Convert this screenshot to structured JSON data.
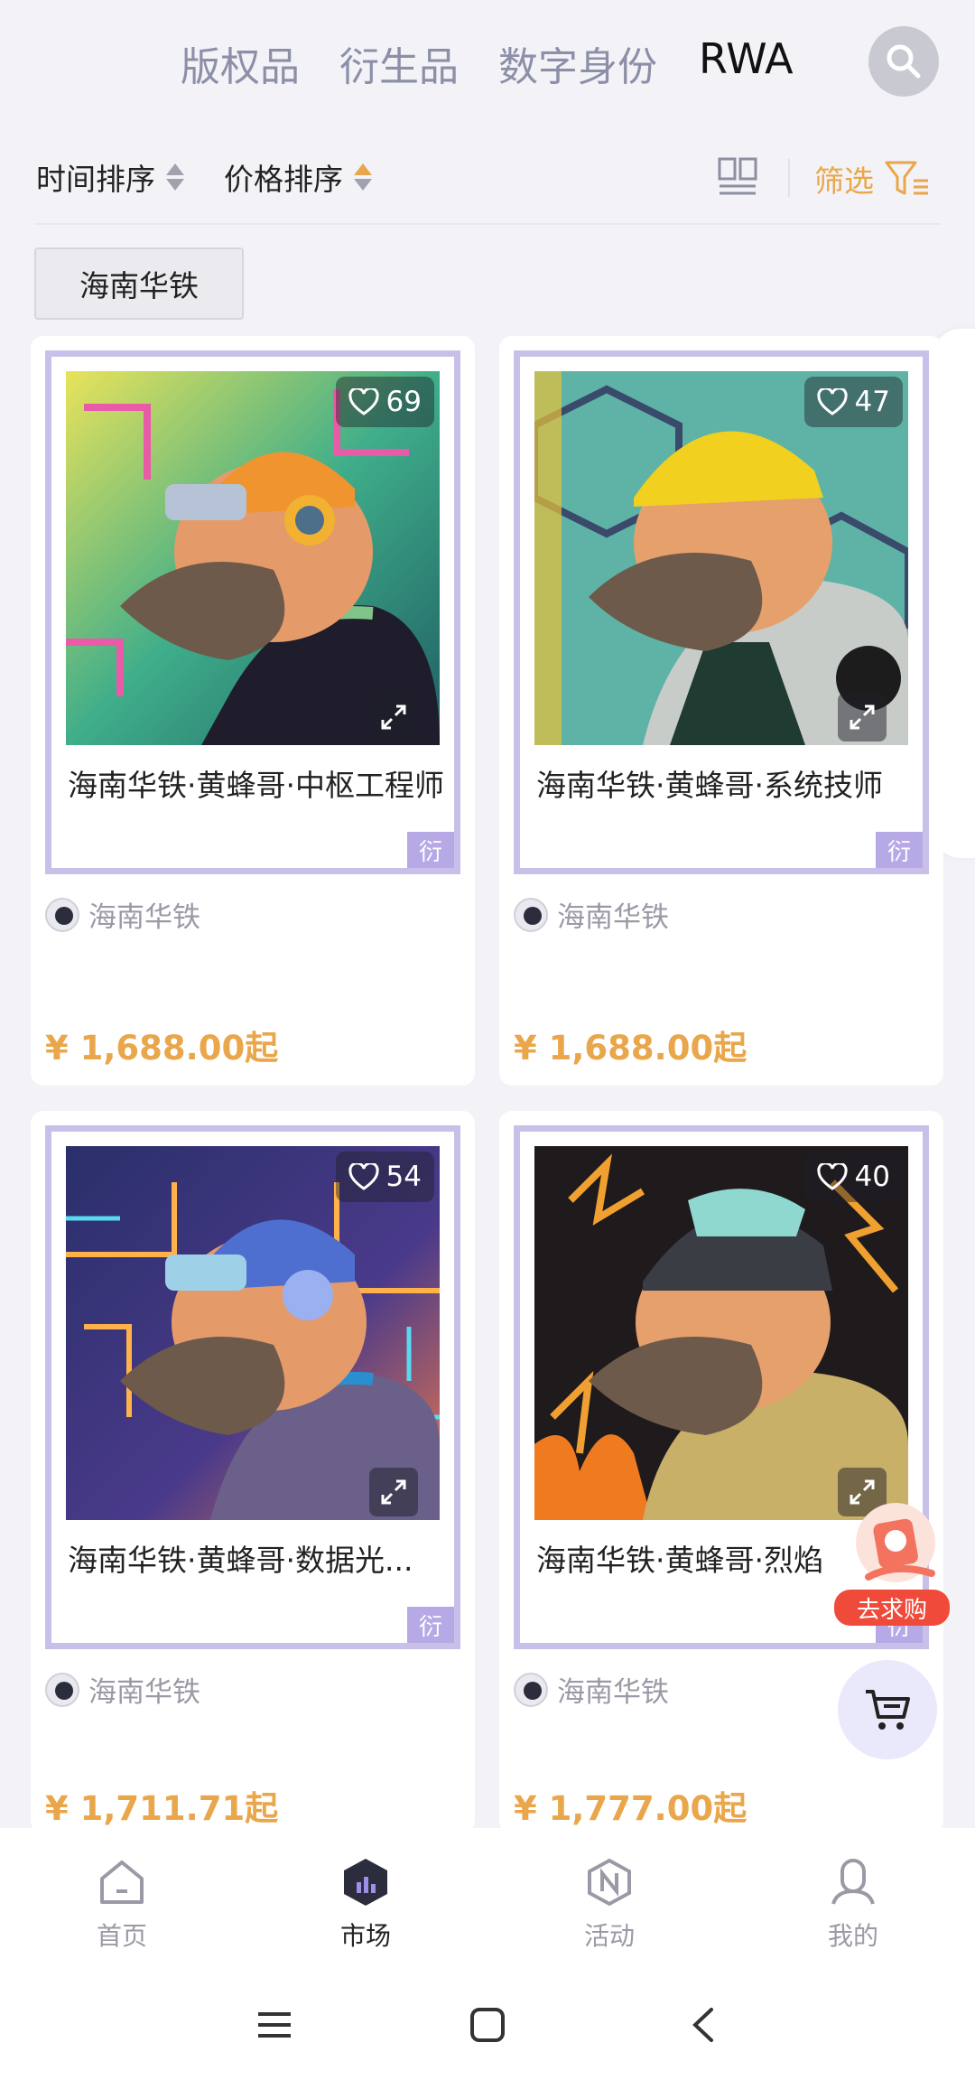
{
  "top_tabs": [
    "版权品",
    "衍生品",
    "数字身份",
    "RWA"
  ],
  "active_tab": "RWA",
  "sort": {
    "time_label": "时间排序",
    "price_label": "价格排序",
    "filter_label": "筛选"
  },
  "chip_label": "海南华铁",
  "cards": [
    {
      "title": "海南华铁·黄蜂哥·中枢工程师",
      "likes": "69",
      "badge": "衍",
      "issuer": "海南华铁",
      "price": "¥ 1,688.00起"
    },
    {
      "title": "海南华铁·黄蜂哥·系统技师",
      "likes": "47",
      "badge": "衍",
      "issuer": "海南华铁",
      "price": "¥ 1,688.00起"
    },
    {
      "title": "海南华铁·黄蜂哥·数据光...",
      "likes": "54",
      "badge": "衍",
      "issuer": "海南华铁",
      "price": "¥ 1,711.71起"
    },
    {
      "title": "海南华铁·黄蜂哥·烈焰",
      "likes": "40",
      "badge": "衍",
      "issuer": "海南华铁",
      "price": "¥ 1,777.00起"
    }
  ],
  "floating": {
    "qiugou_label": "去求购"
  },
  "bottom_nav": [
    {
      "label": "首页"
    },
    {
      "label": "市场"
    },
    {
      "label": "活动"
    },
    {
      "label": "我的"
    }
  ],
  "colors": {
    "accent": "#e9a64a",
    "frame": "#c9c0ea",
    "badge": "#b7a9e6",
    "tab_inactive": "#8c8fa8"
  }
}
